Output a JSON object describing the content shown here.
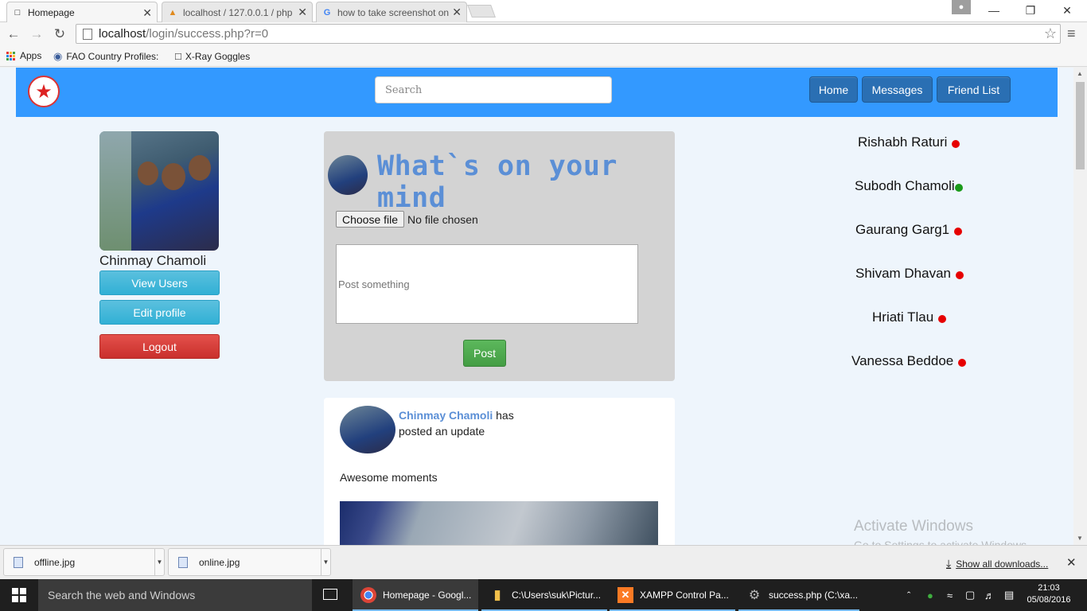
{
  "browser": {
    "tabs": [
      {
        "title": "Homepage",
        "active": true
      },
      {
        "title": "localhost / 127.0.0.1 / php",
        "active": false
      },
      {
        "title": "how to take screenshot on",
        "active": false
      }
    ],
    "address": {
      "host": "localhost",
      "path": "/login/success.php?r=0"
    },
    "bookmarks": [
      "Apps",
      "FAO Country Profiles:",
      "X-Ray Goggles"
    ]
  },
  "site": {
    "search_placeholder": "Search",
    "nav": [
      "Home",
      "Messages",
      "Friend List"
    ],
    "profile": {
      "name": "Chinmay Chamoli",
      "buttons": {
        "view_users": "View Users",
        "edit_profile": "Edit profile",
        "logout": "Logout"
      }
    },
    "composer": {
      "headline": "What`s on your mind",
      "file_button": "Choose file",
      "file_status": "No file chosen",
      "textarea_placeholder": "Post something",
      "post_button": "Post"
    },
    "feed": [
      {
        "author": "Chinmay Chamoli",
        "action_1": "has",
        "action_2": "posted an update",
        "text": "Awesome moments"
      }
    ],
    "friends": [
      {
        "name": "Rishabh Raturi",
        "status": "offline"
      },
      {
        "name": "Subodh Chamoli",
        "status": "online"
      },
      {
        "name": "Gaurang Garg1",
        "status": "offline"
      },
      {
        "name": "Shivam Dhavan",
        "status": "offline"
      },
      {
        "name": "Hriati Tlau",
        "status": "offline"
      },
      {
        "name": "Vanessa Beddoe",
        "status": "offline"
      }
    ],
    "status_colors": {
      "online": "#1a9a1a",
      "offline": "#e60000"
    }
  },
  "watermark": {
    "line1": "Activate Windows",
    "line2": "Go to Settings to activate Windows."
  },
  "downloads": {
    "items": [
      "offline.jpg",
      "online.jpg"
    ],
    "show_all": "Show all downloads..."
  },
  "taskbar": {
    "search_placeholder": "Search the web and Windows",
    "items": [
      {
        "label": "Homepage - Googl...",
        "active": true
      },
      {
        "label": "C:\\Users\\suk\\Pictur...",
        "active": false
      },
      {
        "label": "XAMPP Control Pa...",
        "active": false
      },
      {
        "label": "success.php (C:\\xa...",
        "active": false
      }
    ],
    "time": "21:03",
    "date": "05/08/2016"
  }
}
